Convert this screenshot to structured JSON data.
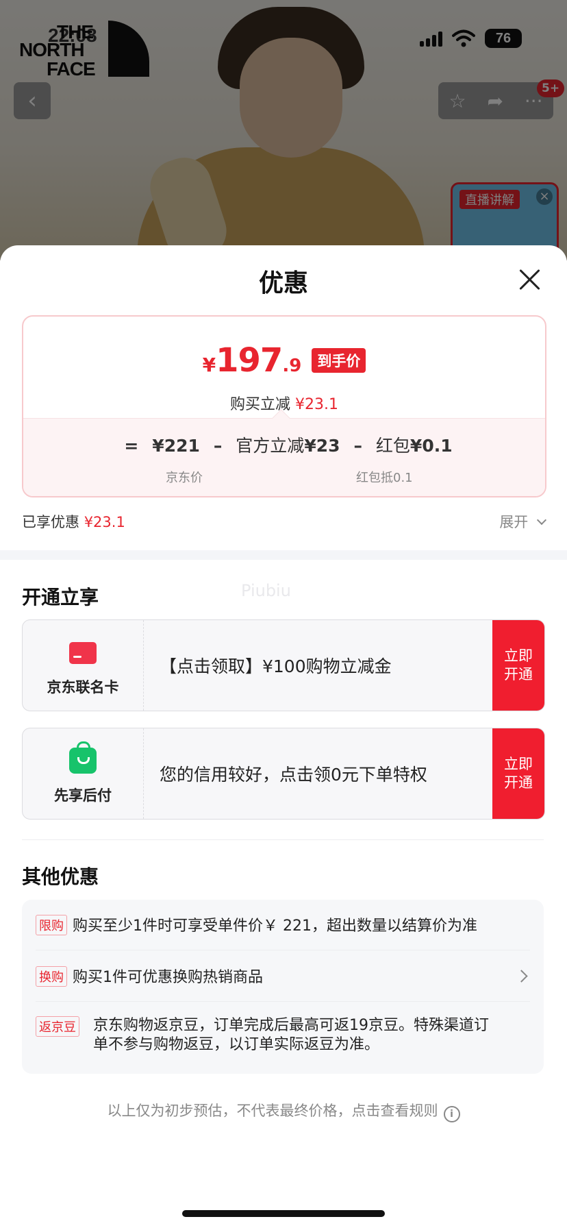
{
  "status_bar": {
    "time": "22:08",
    "battery": "76"
  },
  "background": {
    "logo_lines": [
      "THE",
      "NORTH",
      "FACE"
    ],
    "nav_badge": "5+",
    "live_thumb_label": "直播讲解"
  },
  "sheet": {
    "title": "优惠",
    "price": {
      "currency": "¥",
      "integer": "197",
      "decimal": ".9",
      "tag": "到手价",
      "sub_label": "购买立减",
      "sub_value": "¥23.1"
    },
    "breakdown": {
      "equals": "=",
      "base_price": "¥221",
      "minus1": "–",
      "official_label": "官方立减",
      "official_value": "¥23",
      "minus2": "–",
      "redpacket_label": "红包",
      "redpacket_value": "¥0.1",
      "base_caption": "京东价",
      "redpacket_caption": "红包抵0.1"
    },
    "enjoyed": {
      "label": "已享优惠",
      "value": "¥23.1"
    },
    "expand_label": "展开",
    "open_section": {
      "title": "开通立享",
      "watermark": "Piubiu",
      "offers": [
        {
          "name": "京东联名卡",
          "icon": "credit-card-icon",
          "text": "【点击领取】¥100购物立减金",
          "button_line1": "立即",
          "button_line2": "开通"
        },
        {
          "name": "先享后付",
          "icon": "shopping-bag-icon",
          "text": "您的信用较好，点击领0元下单特权",
          "button_line1": "立即",
          "button_line2": "开通"
        }
      ]
    },
    "other_section": {
      "title": "其他优惠",
      "rows": [
        {
          "tag": "限购",
          "text": "购买至少1件时可享受单件价￥ 221，超出数量以结算价为准"
        },
        {
          "tag": "换购",
          "text": "购买1件可优惠换购热销商品"
        },
        {
          "tag": "返京豆",
          "text_line1": "京东购物返京豆，订单完成后最高可返19京豆。特殊渠道订",
          "text_line2": "单不参与购物返豆，以订单实际返豆为准。"
        }
      ]
    },
    "footer_note": "以上仅为初步预估，不代表最终价格，点击查看规则",
    "info_symbol": "i"
  },
  "colors": {
    "accent_red": "#e8252f",
    "button_red": "#f01e2f",
    "bag_green": "#17c36b"
  }
}
